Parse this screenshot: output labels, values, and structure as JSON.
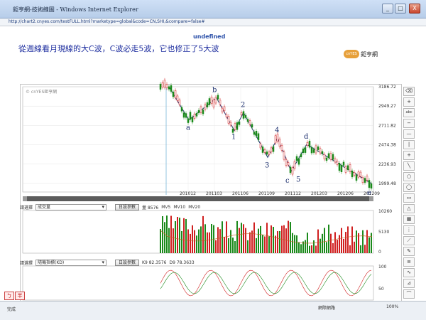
{
  "window": {
    "title": "鉅亨網-技術線圖 - Windows Internet Explorer",
    "url": "http://chart2.cnyes.com/testFULL.html?marketype=global&code=CN,SHI,&compare=false#",
    "buttons": [
      "_",
      "□",
      "X"
    ]
  },
  "page": {
    "undefined_text": "undefined",
    "heading": "從週線看月現線的大C波，C波必走5波，它也修正了5大波",
    "logo_badge": "cnYES",
    "logo_name": "鉅亨網",
    "chart_watermark": "© cnYES鉅亨網"
  },
  "price_panel": {
    "y_ticks": [
      "3186.72",
      "2949.27",
      "2711.82",
      "2474.38",
      "2236.93",
      "1999.48"
    ],
    "x_ticks": [
      "201012",
      "201103",
      "201106",
      "201109",
      "201112",
      "201203",
      "201206",
      "201209"
    ],
    "wave_labels": [
      "a",
      "b",
      "1",
      "2",
      "3",
      "4",
      "c",
      "5",
      "d",
      "e"
    ]
  },
  "volume_panel": {
    "select_label": "請選擇",
    "select_value": "成交量",
    "settings_button": "日設參數",
    "legend": [
      "量 8576",
      "MV5",
      "MV10",
      "MV20"
    ],
    "y_ticks": [
      "10260",
      "5130",
      "0"
    ]
  },
  "kd_panel": {
    "select_label": "請選擇",
    "select_value": "隨機指標(KD)",
    "settings_button": "日設參數",
    "legend": [
      "K9 82.3576",
      "D9 78.3633"
    ],
    "y_ticks": [
      "100",
      "50"
    ]
  },
  "side_tools": [
    "eraser-icon",
    "plus-icon",
    "abc-icon",
    "minus-icon",
    "horizontal-line-icon",
    "vertical-line-icon",
    "cross-icon",
    "diagonal-line-icon",
    "circle-icon",
    "ellipse-icon",
    "rectangle-icon",
    "triangle-icon",
    "grid-icon",
    "ruler-icon",
    "fan-icon",
    "pen-icon",
    "fibonacci-icon",
    "wave-icon",
    "gann-icon",
    "arc-icon"
  ],
  "tabs": [
    "ㄅ",
    "半"
  ],
  "status": {
    "left": "完成",
    "zone": "網際網路",
    "zoom": "100%"
  },
  "chart_data": [
    {
      "type": "candlestick",
      "x": [
        "201012",
        "201103",
        "201106",
        "201109",
        "201112",
        "201203",
        "201206",
        "201209"
      ],
      "ylim": [
        1999.48,
        3186.72
      ],
      "wave_points": [
        {
          "label": "a",
          "x": "201012",
          "y": 2780
        },
        {
          "label": "b",
          "x": "201103",
          "y": 3050
        },
        {
          "label": "1",
          "x": "201106",
          "y": 2650
        },
        {
          "label": "2",
          "x": "201106",
          "y": 2870
        },
        {
          "label": "3",
          "x": "201109",
          "y": 2320
        },
        {
          "label": "4",
          "x": "201109",
          "y": 2560
        },
        {
          "label": "c",
          "x": "201112",
          "y": 2150
        },
        {
          "label": "5",
          "x": "201112",
          "y": 2160
        },
        {
          "label": "d",
          "x": "201203",
          "y": 2480
        },
        {
          "label": "e",
          "x": "201209",
          "y": 2000
        }
      ]
    },
    {
      "type": "bar",
      "ylim": [
        0,
        10260
      ],
      "series": [
        {
          "name": "量 8576"
        },
        {
          "name": "MV5"
        },
        {
          "name": "MV10"
        },
        {
          "name": "MV20"
        }
      ]
    },
    {
      "type": "line",
      "ylim": [
        0,
        100
      ],
      "series": [
        {
          "name": "K9 82.3576"
        },
        {
          "name": "D9 78.3633"
        }
      ]
    }
  ]
}
